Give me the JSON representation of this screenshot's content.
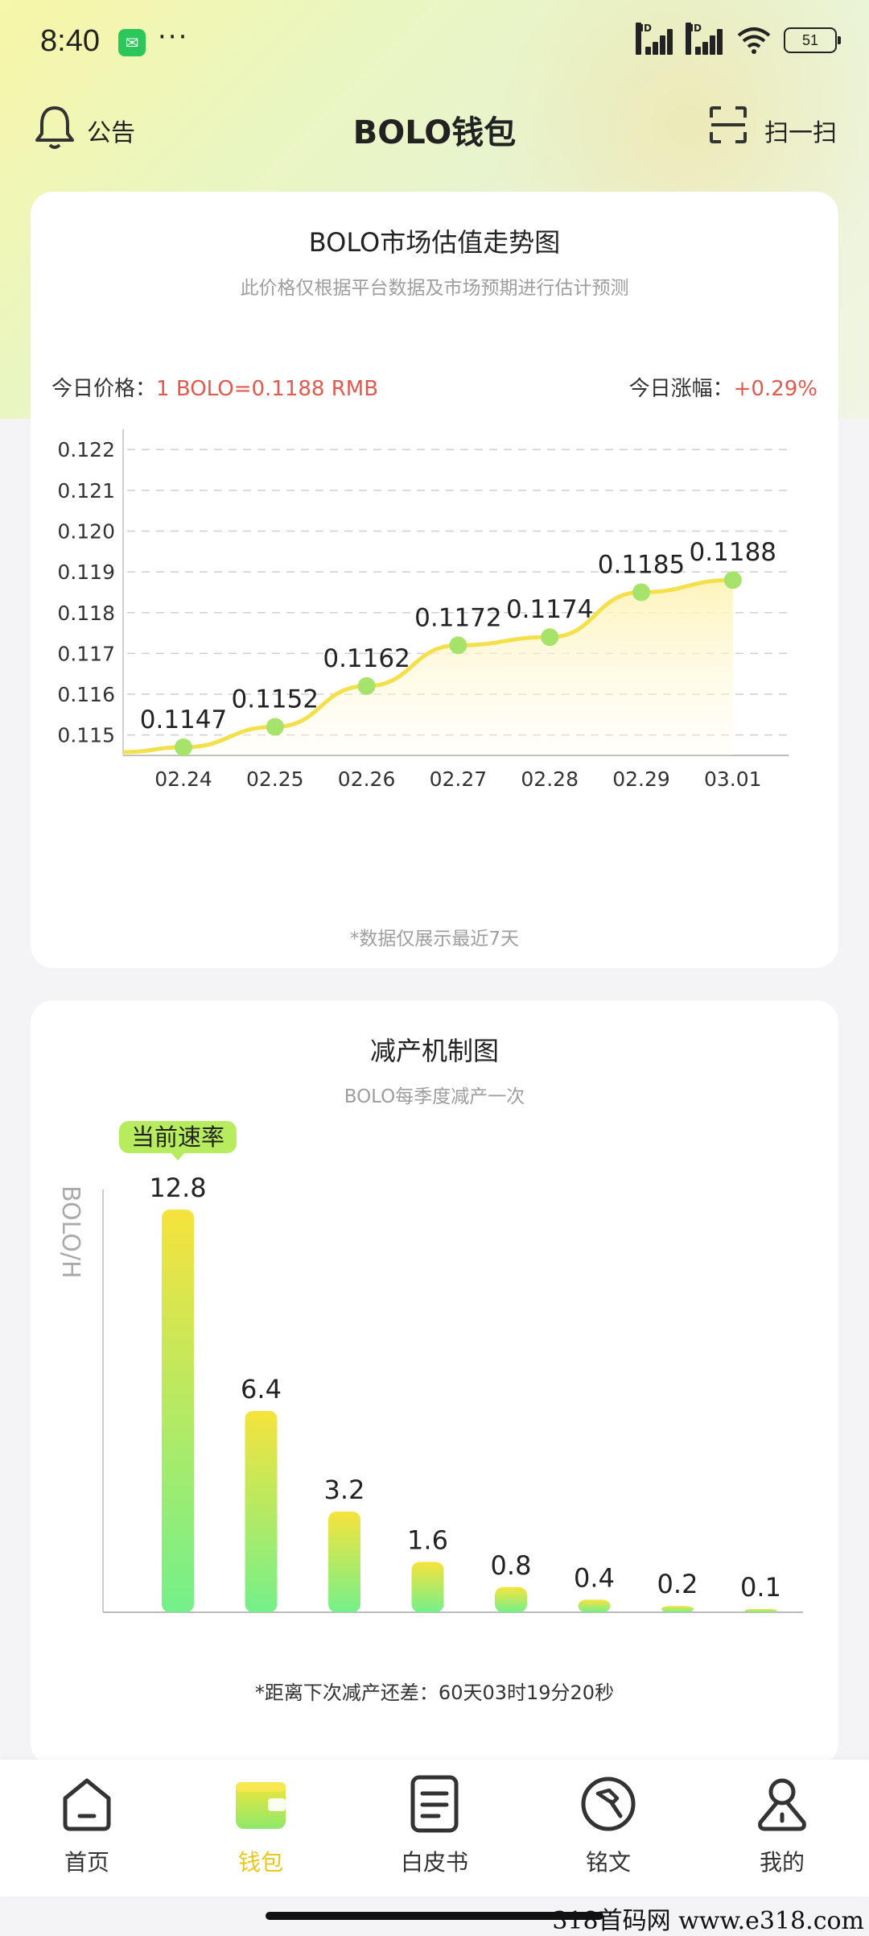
{
  "status_bar": {
    "time": "8:40",
    "battery": "51",
    "more": "···",
    "network_label": "HD"
  },
  "header": {
    "notice_label": "公告",
    "title": "BOLO钱包",
    "scan_label": "扫一扫"
  },
  "price_card": {
    "title": "BOLO市场估值走势图",
    "subtitle": "此价格仅根据平台数据及市场预期进行估计预测",
    "today_price_label": "今日价格：",
    "today_price_value": "1 BOLO=0.1188 RMB",
    "today_change_label": "今日涨幅：",
    "today_change_value": "+0.29%",
    "footnote": "*数据仅展示最近7天"
  },
  "halving_card": {
    "title": "减产机制图",
    "subtitle": "BOLO每季度减产一次",
    "footnote": "*距离下次减产还差：60天03时19分20秒"
  },
  "chart_data": [
    {
      "type": "line",
      "categories": [
        "02.24",
        "02.25",
        "02.26",
        "02.27",
        "02.28",
        "02.29",
        "03.01"
      ],
      "values": [
        0.1147,
        0.1152,
        0.1162,
        0.1172,
        0.1174,
        0.1185,
        0.1188
      ],
      "data_labels": [
        "0.1147",
        "0.1152",
        "0.1162",
        "0.1172",
        "0.1174",
        "0.1185",
        "0.1188"
      ],
      "yticks": [
        "0.115",
        "0.116",
        "0.117",
        "0.118",
        "0.119",
        "0.120",
        "0.121",
        "0.122"
      ],
      "ylim": [
        0.1145,
        0.1223
      ],
      "grid": true,
      "colors": {
        "line": "#f4e04a",
        "point": "#a6e36a",
        "area": "#fdf3b8"
      }
    },
    {
      "type": "bar",
      "ylabel": "BOLO/H",
      "values": [
        12.8,
        6.4,
        3.2,
        1.6,
        0.8,
        0.4,
        0.2,
        0.1
      ],
      "data_labels": [
        "12.8",
        "6.4",
        "3.2",
        "1.6",
        "0.8",
        "0.4",
        "0.2",
        "0.1"
      ],
      "current_index": 0,
      "current_badge": "当前速率",
      "ylim": [
        0,
        12.8
      ],
      "colors": {
        "top": "#f6e33c",
        "bottom": "#74f08a",
        "badge": "#b7ec5e"
      }
    }
  ],
  "bottom_nav": [
    {
      "label": "首页",
      "icon": "home-icon"
    },
    {
      "label": "钱包",
      "icon": "wallet-icon",
      "active": true
    },
    {
      "label": "白皮书",
      "icon": "document-icon"
    },
    {
      "label": "铭文",
      "icon": "hammer-icon"
    },
    {
      "label": "我的",
      "icon": "user-icon"
    }
  ],
  "watermark": "318首码网  www.e318.com"
}
